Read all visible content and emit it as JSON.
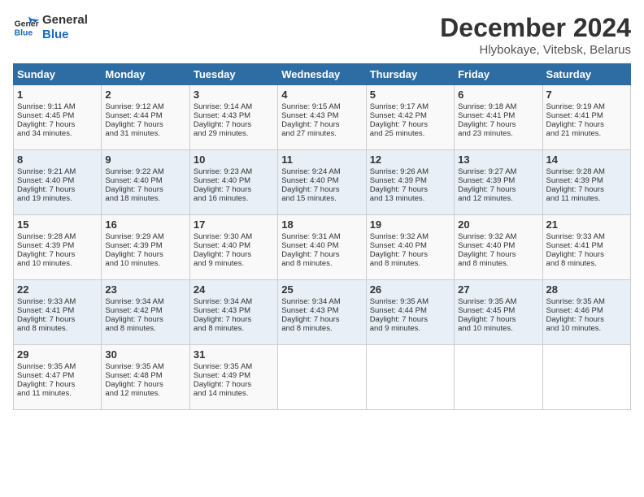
{
  "logo": {
    "line1": "General",
    "line2": "Blue"
  },
  "title": "December 2024",
  "subtitle": "Hlybokaye, Vitebsk, Belarus",
  "headers": [
    "Sunday",
    "Monday",
    "Tuesday",
    "Wednesday",
    "Thursday",
    "Friday",
    "Saturday"
  ],
  "weeks": [
    [
      {
        "day": "1",
        "sunrise": "Sunrise: 9:11 AM",
        "sunset": "Sunset: 4:45 PM",
        "daylight": "Daylight: 7 hours and 34 minutes."
      },
      {
        "day": "2",
        "sunrise": "Sunrise: 9:12 AM",
        "sunset": "Sunset: 4:44 PM",
        "daylight": "Daylight: 7 hours and 31 minutes."
      },
      {
        "day": "3",
        "sunrise": "Sunrise: 9:14 AM",
        "sunset": "Sunset: 4:43 PM",
        "daylight": "Daylight: 7 hours and 29 minutes."
      },
      {
        "day": "4",
        "sunrise": "Sunrise: 9:15 AM",
        "sunset": "Sunset: 4:43 PM",
        "daylight": "Daylight: 7 hours and 27 minutes."
      },
      {
        "day": "5",
        "sunrise": "Sunrise: 9:17 AM",
        "sunset": "Sunset: 4:42 PM",
        "daylight": "Daylight: 7 hours and 25 minutes."
      },
      {
        "day": "6",
        "sunrise": "Sunrise: 9:18 AM",
        "sunset": "Sunset: 4:41 PM",
        "daylight": "Daylight: 7 hours and 23 minutes."
      },
      {
        "day": "7",
        "sunrise": "Sunrise: 9:19 AM",
        "sunset": "Sunset: 4:41 PM",
        "daylight": "Daylight: 7 hours and 21 minutes."
      }
    ],
    [
      {
        "day": "8",
        "sunrise": "Sunrise: 9:21 AM",
        "sunset": "Sunset: 4:40 PM",
        "daylight": "Daylight: 7 hours and 19 minutes."
      },
      {
        "day": "9",
        "sunrise": "Sunrise: 9:22 AM",
        "sunset": "Sunset: 4:40 PM",
        "daylight": "Daylight: 7 hours and 18 minutes."
      },
      {
        "day": "10",
        "sunrise": "Sunrise: 9:23 AM",
        "sunset": "Sunset: 4:40 PM",
        "daylight": "Daylight: 7 hours and 16 minutes."
      },
      {
        "day": "11",
        "sunrise": "Sunrise: 9:24 AM",
        "sunset": "Sunset: 4:40 PM",
        "daylight": "Daylight: 7 hours and 15 minutes."
      },
      {
        "day": "12",
        "sunrise": "Sunrise: 9:26 AM",
        "sunset": "Sunset: 4:39 PM",
        "daylight": "Daylight: 7 hours and 13 minutes."
      },
      {
        "day": "13",
        "sunrise": "Sunrise: 9:27 AM",
        "sunset": "Sunset: 4:39 PM",
        "daylight": "Daylight: 7 hours and 12 minutes."
      },
      {
        "day": "14",
        "sunrise": "Sunrise: 9:28 AM",
        "sunset": "Sunset: 4:39 PM",
        "daylight": "Daylight: 7 hours and 11 minutes."
      }
    ],
    [
      {
        "day": "15",
        "sunrise": "Sunrise: 9:28 AM",
        "sunset": "Sunset: 4:39 PM",
        "daylight": "Daylight: 7 hours and 10 minutes."
      },
      {
        "day": "16",
        "sunrise": "Sunrise: 9:29 AM",
        "sunset": "Sunset: 4:39 PM",
        "daylight": "Daylight: 7 hours and 10 minutes."
      },
      {
        "day": "17",
        "sunrise": "Sunrise: 9:30 AM",
        "sunset": "Sunset: 4:40 PM",
        "daylight": "Daylight: 7 hours and 9 minutes."
      },
      {
        "day": "18",
        "sunrise": "Sunrise: 9:31 AM",
        "sunset": "Sunset: 4:40 PM",
        "daylight": "Daylight: 7 hours and 8 minutes."
      },
      {
        "day": "19",
        "sunrise": "Sunrise: 9:32 AM",
        "sunset": "Sunset: 4:40 PM",
        "daylight": "Daylight: 7 hours and 8 minutes."
      },
      {
        "day": "20",
        "sunrise": "Sunrise: 9:32 AM",
        "sunset": "Sunset: 4:40 PM",
        "daylight": "Daylight: 7 hours and 8 minutes."
      },
      {
        "day": "21",
        "sunrise": "Sunrise: 9:33 AM",
        "sunset": "Sunset: 4:41 PM",
        "daylight": "Daylight: 7 hours and 8 minutes."
      }
    ],
    [
      {
        "day": "22",
        "sunrise": "Sunrise: 9:33 AM",
        "sunset": "Sunset: 4:41 PM",
        "daylight": "Daylight: 7 hours and 8 minutes."
      },
      {
        "day": "23",
        "sunrise": "Sunrise: 9:34 AM",
        "sunset": "Sunset: 4:42 PM",
        "daylight": "Daylight: 7 hours and 8 minutes."
      },
      {
        "day": "24",
        "sunrise": "Sunrise: 9:34 AM",
        "sunset": "Sunset: 4:43 PM",
        "daylight": "Daylight: 7 hours and 8 minutes."
      },
      {
        "day": "25",
        "sunrise": "Sunrise: 9:34 AM",
        "sunset": "Sunset: 4:43 PM",
        "daylight": "Daylight: 7 hours and 8 minutes."
      },
      {
        "day": "26",
        "sunrise": "Sunrise: 9:35 AM",
        "sunset": "Sunset: 4:44 PM",
        "daylight": "Daylight: 7 hours and 9 minutes."
      },
      {
        "day": "27",
        "sunrise": "Sunrise: 9:35 AM",
        "sunset": "Sunset: 4:45 PM",
        "daylight": "Daylight: 7 hours and 10 minutes."
      },
      {
        "day": "28",
        "sunrise": "Sunrise: 9:35 AM",
        "sunset": "Sunset: 4:46 PM",
        "daylight": "Daylight: 7 hours and 10 minutes."
      }
    ],
    [
      {
        "day": "29",
        "sunrise": "Sunrise: 9:35 AM",
        "sunset": "Sunset: 4:47 PM",
        "daylight": "Daylight: 7 hours and 11 minutes."
      },
      {
        "day": "30",
        "sunrise": "Sunrise: 9:35 AM",
        "sunset": "Sunset: 4:48 PM",
        "daylight": "Daylight: 7 hours and 12 minutes."
      },
      {
        "day": "31",
        "sunrise": "Sunrise: 9:35 AM",
        "sunset": "Sunset: 4:49 PM",
        "daylight": "Daylight: 7 hours and 14 minutes."
      },
      null,
      null,
      null,
      null
    ]
  ]
}
